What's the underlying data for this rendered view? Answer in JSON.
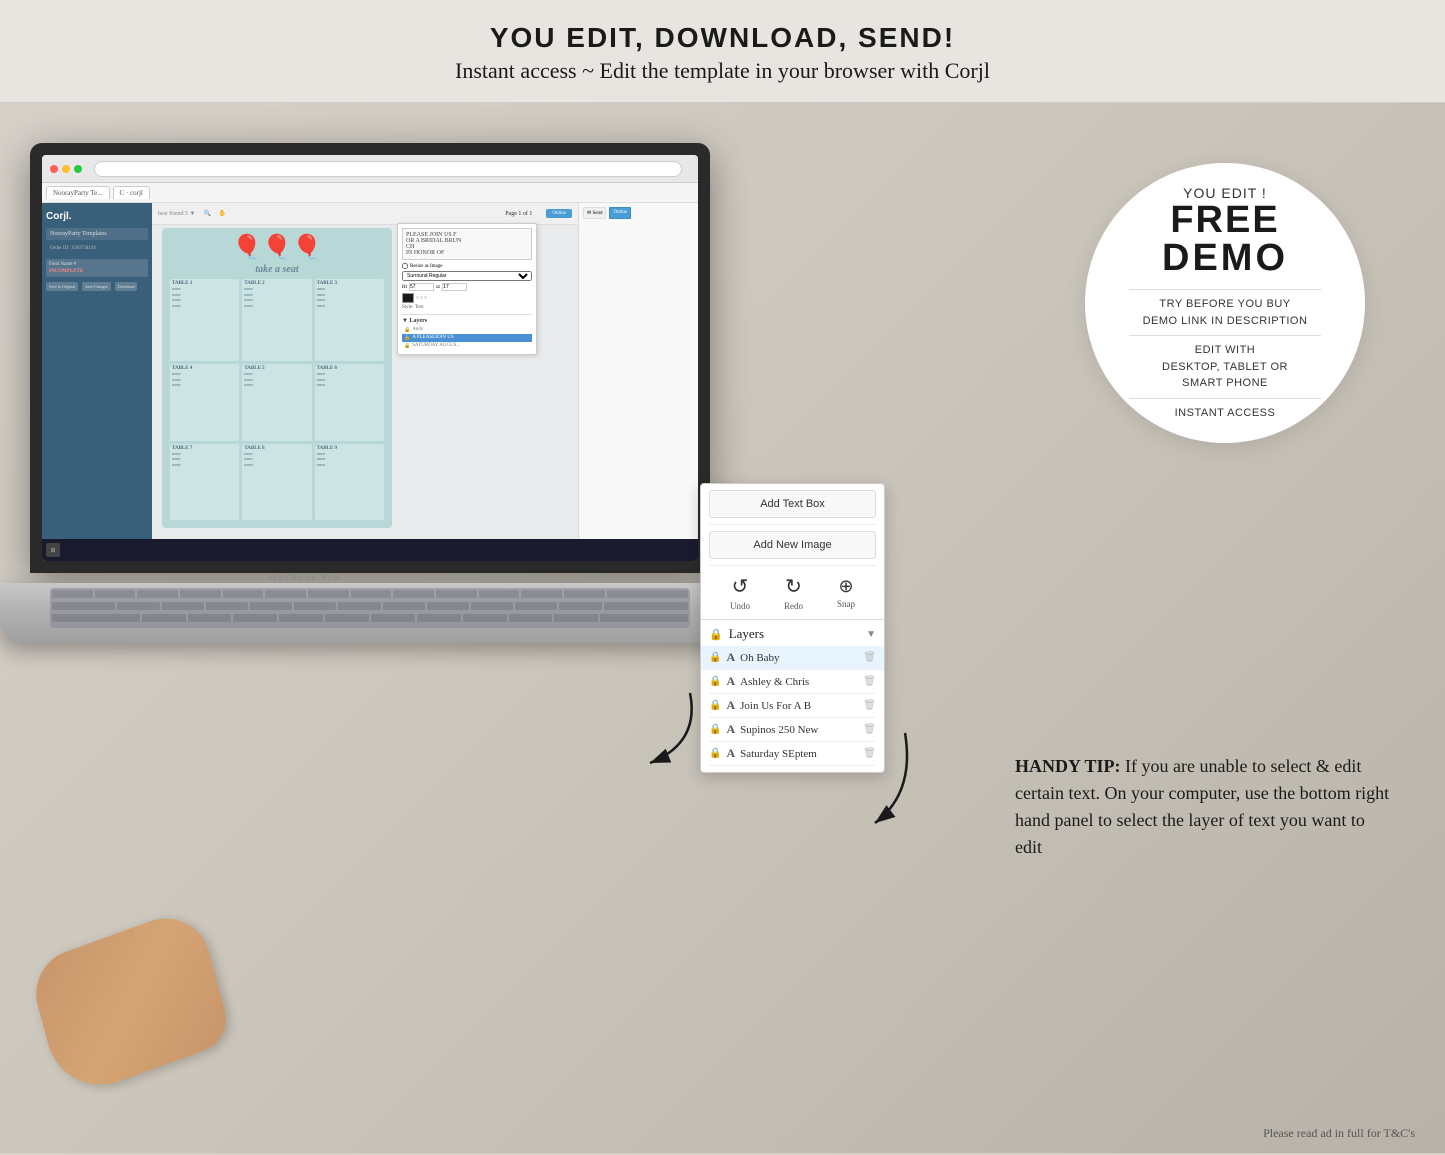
{
  "banner": {
    "headline": "YOU EDIT, DOWNLOAD, SEND!",
    "subline": "Instant access ~ Edit the template in your browser with Corjl"
  },
  "demo_circle": {
    "you_edit": "YOU EDIT !",
    "free": "FREE",
    "demo": "DEMO",
    "try_before": "TRY BEFORE YOU BUY",
    "demo_link": "DEMO LINK IN DESCRIPTION",
    "edit_with": "EDIT WITH",
    "platforms": "DESKTOP, TABLET OR",
    "smartphone": "SMART PHONE",
    "instant": "INSTANT ACCESS"
  },
  "floating_panel": {
    "add_text_box": "Add Text Box",
    "add_new_image": "Add New Image",
    "undo_label": "Undo",
    "redo_label": "Redo",
    "snap_label": "Snap",
    "layers_label": "Layers",
    "layers": [
      {
        "name": "Oh Baby",
        "highlight": true
      },
      {
        "name": "Ashley & Chris",
        "highlight": false
      },
      {
        "name": "Join Us For A B",
        "highlight": false
      },
      {
        "name": "Supinos 250 New",
        "highlight": false
      },
      {
        "name": "Saturday SEptem",
        "highlight": false
      }
    ]
  },
  "handy_tip": {
    "text": "HANDY TIP: If you are unable to select & edit certain text. On your computer, use the bottom right hand panel to select the layer of text you want to edit"
  },
  "footer": {
    "text": "Please read ad in full for T&C's"
  },
  "corjl": {
    "order_id": "Order ID: 1500758194",
    "page_label": "Page 1 of 1",
    "incomplete_badge": "INCOMPLETE",
    "table_title": "Take a Seat"
  },
  "macbook_label": "MacBook Pro"
}
